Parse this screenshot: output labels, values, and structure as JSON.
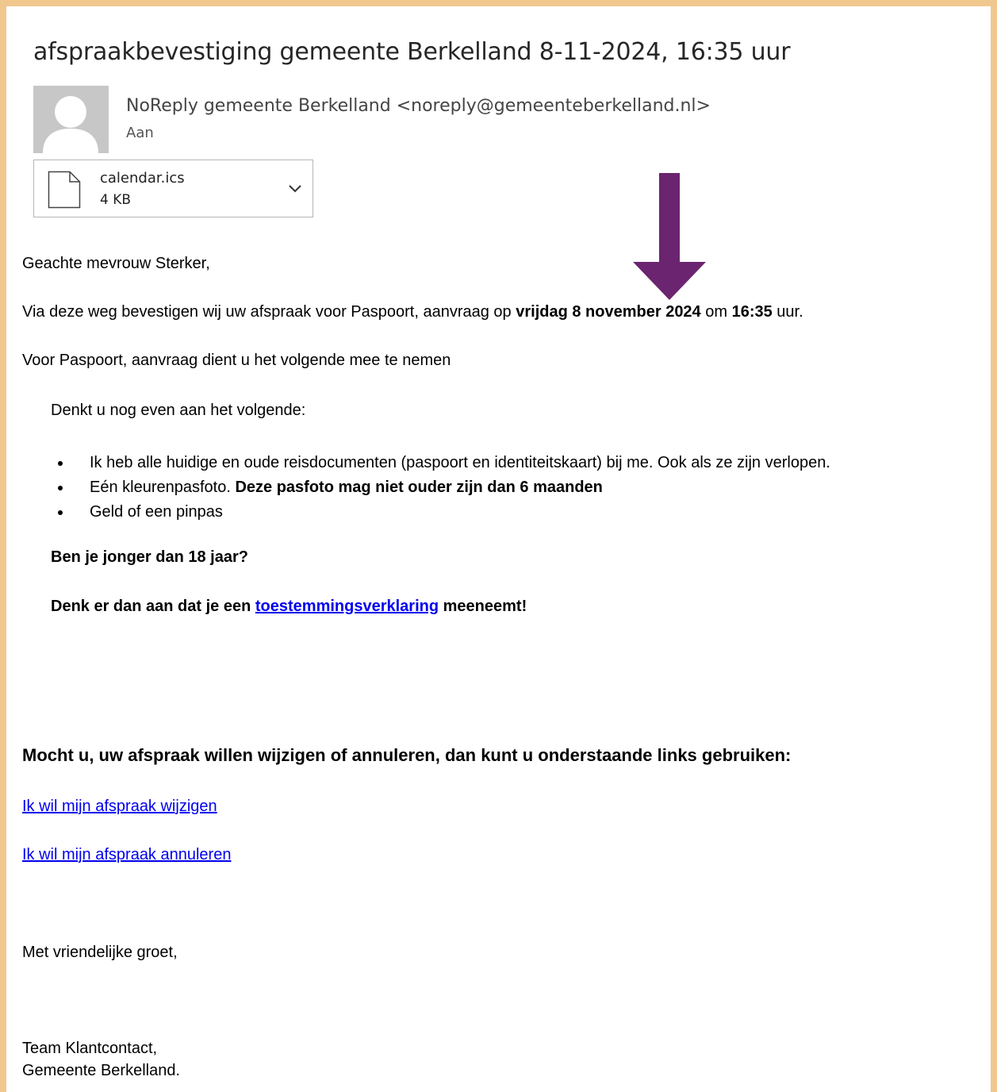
{
  "email": {
    "subject": "afspraakbevestiging gemeente Berkelland 8-11-2024, 16:35 uur",
    "sender": "NoReply gemeente Berkelland <noreply@gemeenteberkelland.nl>",
    "to_label": "Aan"
  },
  "attachment": {
    "icon": "file-icon",
    "name": "calendar.ics",
    "size": "4 KB"
  },
  "annotation": {
    "arrow_color": "#6b2470"
  },
  "body": {
    "greeting": "Geachte mevrouw Sterker,",
    "confirm_prefix": "Via deze weg bevestigen wij uw afspraak voor Paspoort, aanvraag op ",
    "confirm_date": "vrijdag 8 november 2024",
    "confirm_mid": " om ",
    "confirm_time": "16:35",
    "confirm_suffix": " uur.",
    "bring_intro": "Voor Paspoort, aanvraag dient u het volgende mee te nemen",
    "reminder_intro": "Denkt u nog even aan het volgende:",
    "bullets": [
      {
        "text": "Ik heb alle huidige en oude reisdocumenten (paspoort en identiteitskaart) bij me. Ook als ze zijn verlopen."
      },
      {
        "text": "Eén kleurenpasfoto. ",
        "bold": "Deze pasfoto mag niet ouder zijn dan 6 maanden"
      },
      {
        "text": "Geld of een pinpas"
      }
    ],
    "minor_question": "Ben je jonger dan 18 jaar?",
    "consent_prefix": "Denk er dan aan dat je een ",
    "consent_link": "toestemmingsverklaring",
    "consent_suffix": " meeneemt!",
    "change_heading": "Mocht u, uw afspraak willen wijzigen of annuleren, dan kunt u onderstaande links gebruiken:",
    "link_change": "Ik wil mijn afspraak wijzigen",
    "link_cancel": "Ik wil mijn afspraak annuleren",
    "closing": "Met vriendelijke groet,",
    "signature_line1": "Team Klantcontact,",
    "signature_line2": "Gemeente Berkelland."
  },
  "colors": {
    "frame": "#f0c88e",
    "link": "#0000ee"
  }
}
